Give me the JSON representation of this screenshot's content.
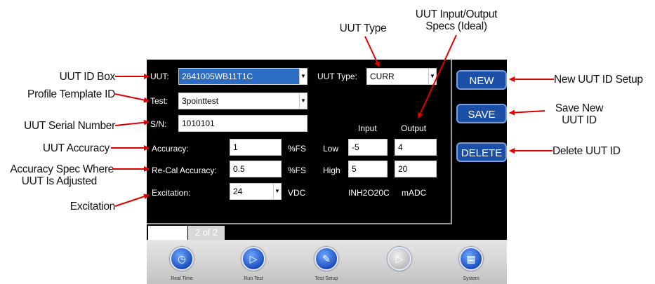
{
  "annotations": {
    "uut_type": "UUT Type",
    "io_specs_line1": "UUT Input/Output",
    "io_specs_line2": "Specs (Ideal)",
    "uut_id_box": "UUT ID Box",
    "profile_template": "Profile Template ID",
    "serial_number": "UUT Serial Number",
    "accuracy": "UUT Accuracy",
    "recal_line1": "Accuracy Spec Where",
    "recal_line2": "UUT Is Adjusted",
    "excitation": "Excitation",
    "new_setup": "New UUT ID Setup",
    "save_line1": "Save New",
    "save_line2": "UUT ID",
    "delete": "Delete UUT ID"
  },
  "form": {
    "uut_label": "UUT:",
    "uut_value": "2641005WB11T1C",
    "uut_type_label": "UUT Type:",
    "uut_type_value": "CURR",
    "test_label": "Test:",
    "test_value": "3pointtest",
    "sn_label": "S/N:",
    "sn_value": "1010101",
    "input_header": "Input",
    "output_header": "Output",
    "accuracy_label": "Accuracy:",
    "accuracy_value": "1",
    "accuracy_unit": "%FS",
    "low_label": "Low",
    "low_input": "-5",
    "low_output": "4",
    "recal_label": "Re-Cal Accuracy:",
    "recal_value": "0.5",
    "recal_unit": "%FS",
    "high_label": "High",
    "high_input": "5",
    "high_output": "20",
    "excitation_label": "Excitation:",
    "excitation_value": "24",
    "excitation_unit": "VDC",
    "input_unit": "INH2O20C",
    "output_unit": "mADC"
  },
  "buttons": {
    "new": "NEW",
    "save": "SAVE",
    "delete": "DELETE"
  },
  "pager": {
    "page": "2 of 2"
  },
  "nav": [
    {
      "label": "Real Time",
      "icon": "clock-icon"
    },
    {
      "label": "Run Test",
      "icon": "play-icon"
    },
    {
      "label": "Test Setup",
      "icon": "wrench-icon"
    },
    {
      "label": "",
      "icon": "disabled-icon"
    },
    {
      "label": "System",
      "icon": "network-icon"
    }
  ],
  "colors": {
    "arrow": "#e00000",
    "button": "#1c4fa8",
    "selection": "#2b6cc4"
  }
}
